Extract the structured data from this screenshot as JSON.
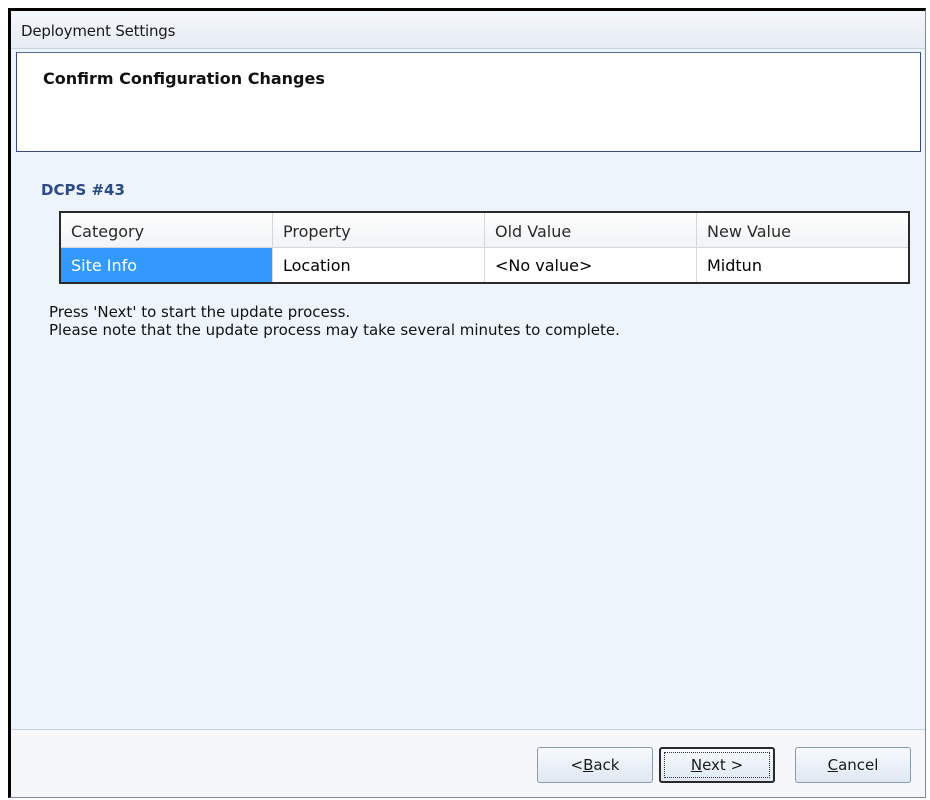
{
  "window": {
    "title": "Deployment Settings"
  },
  "header": {
    "title": "Confirm Configuration Changes"
  },
  "section": {
    "title": "DCPS #43"
  },
  "table": {
    "columns": [
      "Category",
      "Property",
      "Old Value",
      "New Value"
    ],
    "rows": [
      {
        "category": "Site Info",
        "property": "Location",
        "old_value": "<No value>",
        "new_value": "Midtun"
      }
    ]
  },
  "info": {
    "line1": "Press 'Next' to start the update process.",
    "line2": "Please note that the update process may take several minutes to complete."
  },
  "buttons": {
    "back": {
      "prefix": "< ",
      "mnemonic": "B",
      "rest": "ack"
    },
    "next": {
      "mnemonic": "N",
      "rest": "ext >"
    },
    "cancel": {
      "mnemonic": "C",
      "rest": "ancel"
    }
  },
  "colors": {
    "selection": "#3399ff",
    "section_title": "#2b4a86",
    "window_bg": "#eef4fb"
  }
}
